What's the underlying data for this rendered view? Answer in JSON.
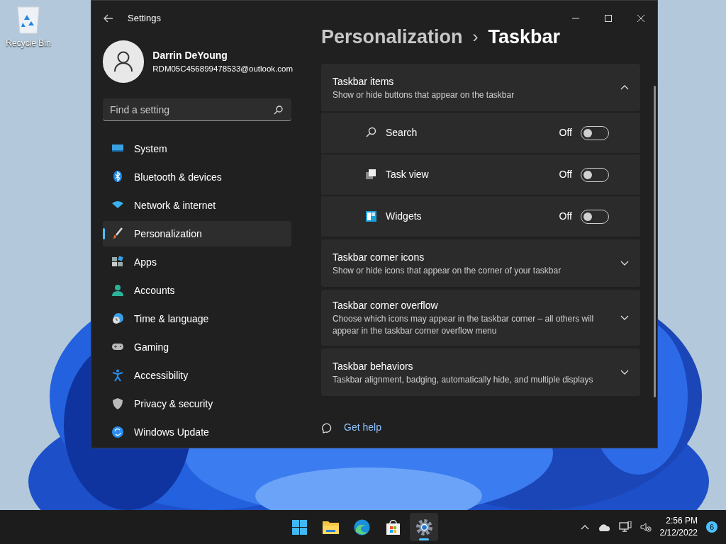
{
  "desktop": {
    "icons": [
      {
        "label": "Recycle Bin"
      }
    ]
  },
  "window": {
    "title": "Settings"
  },
  "profile": {
    "name": "Darrin DeYoung",
    "email": "RDM05C456899478533@outlook.com"
  },
  "search": {
    "placeholder": "Find a setting"
  },
  "sidebar": {
    "items": [
      {
        "label": "System",
        "selected": false
      },
      {
        "label": "Bluetooth & devices",
        "selected": false
      },
      {
        "label": "Network & internet",
        "selected": false
      },
      {
        "label": "Personalization",
        "selected": true
      },
      {
        "label": "Apps",
        "selected": false
      },
      {
        "label": "Accounts",
        "selected": false
      },
      {
        "label": "Time & language",
        "selected": false
      },
      {
        "label": "Gaming",
        "selected": false
      },
      {
        "label": "Accessibility",
        "selected": false
      },
      {
        "label": "Privacy & security",
        "selected": false
      },
      {
        "label": "Windows Update",
        "selected": false
      }
    ]
  },
  "breadcrumb": {
    "parent": "Personalization",
    "separator": "›",
    "current": "Taskbar"
  },
  "sections": [
    {
      "title": "Taskbar items",
      "description": "Show or hide buttons that appear on the taskbar",
      "expanded": true,
      "items": [
        {
          "label": "Search",
          "state": "Off",
          "on": false
        },
        {
          "label": "Task view",
          "state": "Off",
          "on": false
        },
        {
          "label": "Widgets",
          "state": "Off",
          "on": false
        }
      ]
    },
    {
      "title": "Taskbar corner icons",
      "description": "Show or hide icons that appear on the corner of your taskbar",
      "expanded": false
    },
    {
      "title": "Taskbar corner overflow",
      "description": "Choose which icons may appear in the taskbar corner – all others will appear in the taskbar corner overflow menu",
      "expanded": false
    },
    {
      "title": "Taskbar behaviors",
      "description": "Taskbar alignment, badging, automatically hide, and multiple displays",
      "expanded": false
    }
  ],
  "help_link": "Get help",
  "taskbar": {
    "apps": [
      {
        "selected": false
      },
      {
        "selected": false
      },
      {
        "selected": false
      },
      {
        "selected": false
      },
      {
        "selected": true
      }
    ],
    "time": "2:56 PM",
    "date": "2/12/2022",
    "notifications": "6"
  }
}
